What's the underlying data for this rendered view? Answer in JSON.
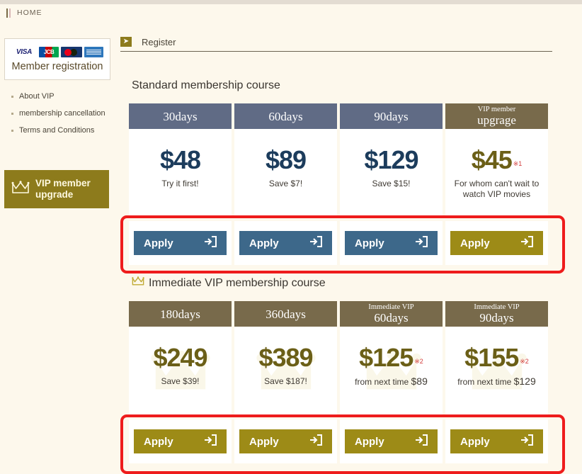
{
  "breadcrumb": {
    "home": "HOME"
  },
  "sidebar": {
    "card": {
      "title": "Member registration",
      "logos": [
        "visa-logo",
        "jcb-logo",
        "mastercard-logo",
        "amex-logo"
      ],
      "logo_labels": {
        "visa": "VISA",
        "jcb": "JCB"
      }
    },
    "links": [
      {
        "label": "About VIP"
      },
      {
        "label": "membership cancellation"
      },
      {
        "label": "Terms and Conditions"
      }
    ],
    "vip_button": {
      "line1": "VIP member",
      "line2": "upgrade",
      "icon": "crown-icon",
      "color": "#8d7b1c"
    }
  },
  "main": {
    "register_heading": "Register",
    "register_icon": "arrow-enter-icon",
    "standard_title": "Standard membership course",
    "vip_title": "Immediate VIP membership course",
    "vip_title_icon": "crown-icon"
  },
  "standard_course": {
    "header_color": "#606b85",
    "vip_header_color": "#786a4b",
    "button_color": "#3d688a",
    "vip_button_color": "#9d8b17",
    "columns": [
      {
        "head_sub": "",
        "head_main": "30days",
        "price": "$48",
        "note": "",
        "sub": "Try it first!",
        "sub_amount": "",
        "style": "blue"
      },
      {
        "head_sub": "",
        "head_main": "60days",
        "price": "$89",
        "note": "",
        "sub": "Save $7!",
        "sub_amount": "",
        "style": "blue"
      },
      {
        "head_sub": "",
        "head_main": "90days",
        "price": "$129",
        "note": "",
        "sub": "Save $15!",
        "sub_amount": "",
        "style": "blue"
      },
      {
        "head_sub": "VIP member",
        "head_main": "upgrage",
        "price": "$45",
        "note": "※1",
        "sub": "For whom can't wait to watch VIP movies",
        "sub_amount": "",
        "style": "gold"
      }
    ],
    "apply_label": "Apply",
    "apply_icon": "login-arrow-icon"
  },
  "vip_course": {
    "header_color": "#786a4b",
    "button_color": "#9d8b17",
    "columns": [
      {
        "head_sub": "",
        "head_main": "180days",
        "price": "$249",
        "note": "",
        "sub": "Save $39!",
        "sub_amount": "",
        "style": "gold"
      },
      {
        "head_sub": "",
        "head_main": "360days",
        "price": "$389",
        "note": "",
        "sub": "Save $187!",
        "sub_amount": "",
        "style": "gold"
      },
      {
        "head_sub": "Immediate VIP",
        "head_main": "60days",
        "price": "$125",
        "note": "※2",
        "sub": "from next time ",
        "sub_amount": "$89",
        "style": "gold"
      },
      {
        "head_sub": "Immediate VIP",
        "head_main": "90days",
        "price": "$155",
        "note": "※2",
        "sub": "from next time ",
        "sub_amount": "$129",
        "style": "gold"
      }
    ],
    "apply_label": "Apply",
    "apply_icon": "login-arrow-icon"
  },
  "annotations": {
    "highlight_color": "#ee1c1c",
    "boxes": [
      "standard-apply-row-highlight",
      "vip-apply-row-highlight"
    ]
  }
}
